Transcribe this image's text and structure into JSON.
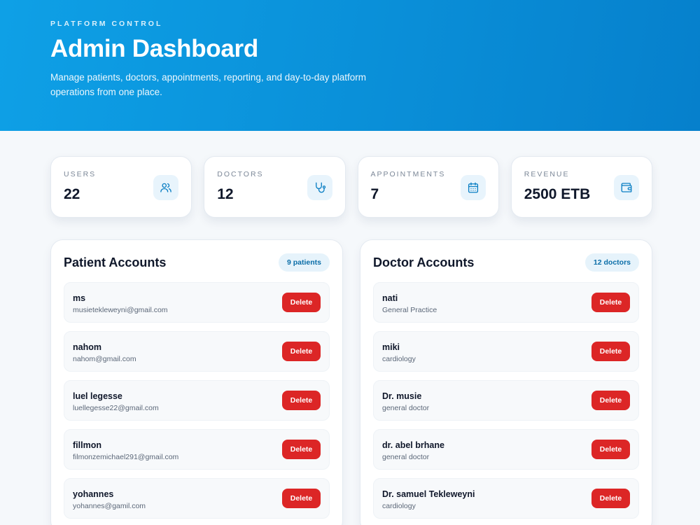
{
  "hero": {
    "eyebrow": "PLATFORM CONTROL",
    "title": "Admin Dashboard",
    "description": "Manage patients, doctors, appointments, reporting, and day-to-day platform operations from one place."
  },
  "stats": [
    {
      "label": "USERS",
      "value": "22",
      "icon": "users-icon"
    },
    {
      "label": "DOCTORS",
      "value": "12",
      "icon": "stethoscope-icon"
    },
    {
      "label": "APPOINTMENTS",
      "value": "7",
      "icon": "calendar-icon"
    },
    {
      "label": "REVENUE",
      "value": "2500 ETB",
      "icon": "wallet-icon"
    }
  ],
  "patients": {
    "title": "Patient Accounts",
    "count_label": "9 patients",
    "items": [
      {
        "name": "ms",
        "sub": "musietekleweyni@gmail.com",
        "action": "Delete"
      },
      {
        "name": "nahom",
        "sub": "nahom@gmail.com",
        "action": "Delete"
      },
      {
        "name": "luel legesse",
        "sub": "luellegesse22@gmail.com",
        "action": "Delete"
      },
      {
        "name": "fillmon",
        "sub": "filmonzemichael291@gmail.com",
        "action": "Delete"
      },
      {
        "name": "yohannes",
        "sub": "yohannes@gamil.com",
        "action": "Delete"
      }
    ]
  },
  "doctors": {
    "title": "Doctor Accounts",
    "count_label": "12 doctors",
    "items": [
      {
        "name": "nati",
        "sub": "General Practice",
        "action": "Delete"
      },
      {
        "name": "miki",
        "sub": "cardiology",
        "action": "Delete"
      },
      {
        "name": "Dr. musie",
        "sub": "general doctor",
        "action": "Delete"
      },
      {
        "name": "dr. abel brhane",
        "sub": "general doctor",
        "action": "Delete"
      },
      {
        "name": "Dr. samuel Tekleweyni",
        "sub": "cardiology",
        "action": "Delete"
      }
    ]
  },
  "colors": {
    "accent": "#0a8fd8",
    "danger": "#dc2626",
    "icon": "#0b7fc4"
  }
}
